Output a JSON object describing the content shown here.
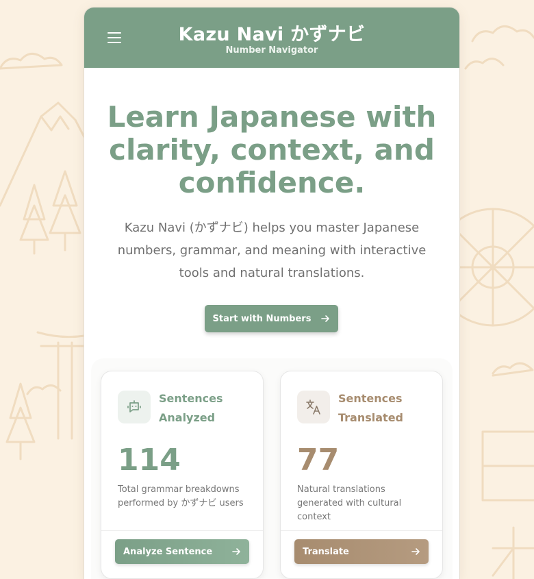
{
  "header": {
    "title": "Kazu Navi かずナビ",
    "subtitle": "Number Navigator",
    "menu_icon": "hamburger-menu-icon"
  },
  "hero": {
    "title": "Learn Japanese with clarity, context, and confidence.",
    "description": "Kazu Navi (かずナビ) helps you master Japanese numbers, grammar, and meaning with interactive tools and natural translations.",
    "cta_label": "Start with Numbers",
    "cta_icon": "arrow-right-icon"
  },
  "cards": [
    {
      "title": "Sentences Analyzed",
      "count": "114",
      "description": "Total grammar breakdowns performed by かずナビ users",
      "button_label": "Analyze Sentence",
      "icon": "robot-icon",
      "accent": "#7b9f87"
    },
    {
      "title": "Sentences Translated",
      "count": "77",
      "description": "Natural translations generated with cultural context",
      "button_label": "Translate",
      "icon": "translate-icon",
      "accent": "#a78c6f"
    }
  ],
  "colors": {
    "primary": "#7b9f87",
    "secondary": "#a78c6f",
    "background": "#fbf1e2"
  }
}
